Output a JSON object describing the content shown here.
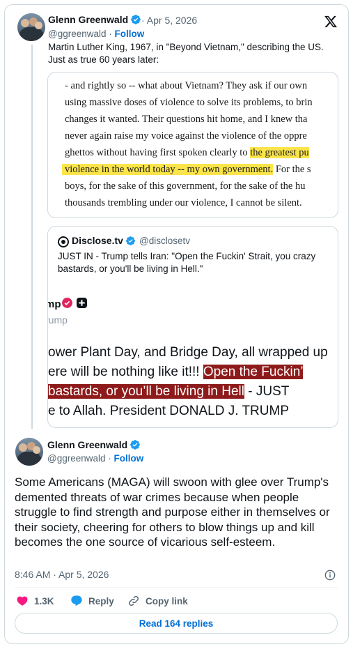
{
  "colors": {
    "accent": "#006fd6",
    "like": "#f91880",
    "highlight_yellow": "#fbe54a",
    "highlight_red": "#8e1b1b",
    "verified": "#1d9bf0"
  },
  "post1": {
    "author_name": "Glenn Greenwald",
    "handle": "@ggreenwald",
    "separator": " · ",
    "follow": "Follow",
    "date": "· Apr 5, 2026",
    "text_line1": "Martin Luther King, 1967, in \"Beyond Vietnam,\" describing the US.",
    "text_line2": "Just as true 60 years later:",
    "scan": {
      "line1": "- and rightly so -- what about Vietnam? They ask if our own",
      "line2": "using massive doses of violence to solve its problems, to brin",
      "line3": "changes it wanted. Their questions hit home, and I knew tha",
      "line4": "never again raise my voice against the violence of the oppre",
      "line5_plain": "ghettos without having first spoken clearly to ",
      "line5_hl": "the greatest pu",
      "line6_hl": "violence in the world today -- my own government.",
      "line6_plain": " For the s",
      "line7": "boys, for the sake of this government, for the sake of the hu",
      "line8": "thousands trembling under our violence, I cannot be silent."
    },
    "quote": {
      "name": "Disclose.tv",
      "handle": "@disclosetv",
      "text": "JUST IN - Trump tells Iran: \"Open the Fuckin' Strait, you crazy bastards, or you'll be living in Hell.\"",
      "image": {
        "name_fragment": "mp",
        "handle_fragment": "rump",
        "line1": "ower Plant Day, and Bridge Day, all wrapped up",
        "line2_plain": "ere will be nothing like it!!! ",
        "line2_red": "Open the Fuckin’",
        "line3_red": "bastards, or you’ll be living in Hell",
        "line3_plain": " - JUST",
        "line4": "e to Allah. President DONALD J. TRUMP"
      }
    }
  },
  "post2": {
    "author_name": "Glenn Greenwald",
    "handle": "@ggreenwald",
    "separator": " · ",
    "follow": "Follow",
    "text": "Some Americans (MAGA) will swoon with glee over Trump's demented threats of war crimes because when people struggle to find strength and purpose either in themselves or their society, cheering for others to blow things up and kill becomes the one source of vicarious self-esteem.",
    "timestamp": "8:46 AM · Apr 5, 2026",
    "likes": "1.3K",
    "reply_label": "Reply",
    "copy_label": "Copy link",
    "read_replies": "Read 164 replies"
  }
}
